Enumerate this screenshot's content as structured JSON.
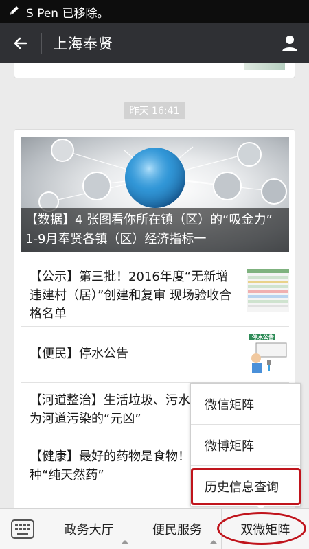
{
  "status_bar": {
    "message": "S Pen 已移除。"
  },
  "nav": {
    "title": "上海奉贤"
  },
  "chat": {
    "timestamp": "昨天 16:41",
    "hero": {
      "caption": "【数据】4 张图看你所在镇（区）的“吸金力” 1-9月奉贤各镇（区）经济指标一"
    },
    "items": [
      {
        "text": "【公示】第三批！2016年度“无新增违建村（居）”创建和复审 现场验收合格名单"
      },
      {
        "text": "【便民】停水公告",
        "thumb_label": "停水公告"
      },
      {
        "text": "【河道整治】生活垃圾、污水排放成为河道污染的“元凶”"
      },
      {
        "text": "【健康】最好的药物是食物！get√20种“纯天然药”"
      }
    ]
  },
  "menu": {
    "buttons": [
      {
        "label": "政务大厅"
      },
      {
        "label": "便民服务"
      },
      {
        "label": "双微矩阵"
      }
    ],
    "popup": [
      {
        "label": "微信矩阵"
      },
      {
        "label": "微博矩阵"
      },
      {
        "label": "历史信息查询"
      }
    ]
  },
  "colors": {
    "nav_bg": "#2f3034",
    "highlight": "#c0141c"
  }
}
